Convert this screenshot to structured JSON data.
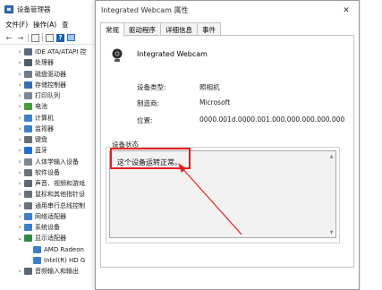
{
  "device_manager": {
    "title": "设备管理器",
    "menu": [
      "文件(F)",
      "操作(A)",
      "查"
    ],
    "tree": [
      {
        "label": "IDE ATA/ATAPI 控",
        "icon_color": "#5a6c7e",
        "indent": 0,
        "expanded": false
      },
      {
        "label": "处理器",
        "icon_color": "#4f5b66",
        "indent": 0,
        "expanded": false
      },
      {
        "label": "磁盘驱动器",
        "icon_color": "#6f7b86",
        "indent": 0,
        "expanded": false
      },
      {
        "label": "存储控制器",
        "icon_color": "#3b6fae",
        "indent": 0,
        "expanded": false
      },
      {
        "label": "打印队列",
        "icon_color": "#7b8893",
        "indent": 0,
        "expanded": false
      },
      {
        "label": "电池",
        "icon_color": "#4a9a3a",
        "indent": 0,
        "expanded": false
      },
      {
        "label": "计算机",
        "icon_color": "#3f7fc7",
        "indent": 0,
        "expanded": false
      },
      {
        "label": "监视器",
        "icon_color": "#3f7fc7",
        "indent": 0,
        "expanded": false
      },
      {
        "label": "键盘",
        "icon_color": "#666f78",
        "indent": 0,
        "expanded": false
      },
      {
        "label": "蓝牙",
        "icon_color": "#1f6fd0",
        "indent": 0,
        "expanded": false
      },
      {
        "label": "人体学输入设备",
        "icon_color": "#7d8791",
        "indent": 0,
        "expanded": false
      },
      {
        "label": "软件设备",
        "icon_color": "#6a737c",
        "indent": 0,
        "expanded": false
      },
      {
        "label": "声音、视频和游戏",
        "icon_color": "#5d6772",
        "indent": 0,
        "expanded": false
      },
      {
        "label": "鼠标和其他指针设",
        "icon_color": "#6a737c",
        "indent": 0,
        "expanded": false
      },
      {
        "label": "通用串行总线控制",
        "icon_color": "#6a737c",
        "indent": 0,
        "expanded": false
      },
      {
        "label": "网络适配器",
        "icon_color": "#3f7fc7",
        "indent": 0,
        "expanded": false
      },
      {
        "label": "系统设备",
        "icon_color": "#3f7fc7",
        "indent": 0,
        "expanded": false
      },
      {
        "label": "显示适配器",
        "icon_color": "#2f8a4a",
        "indent": 0,
        "expanded": true
      },
      {
        "label": "AMD Radeon",
        "icon_color": "#3f7fc7",
        "indent": 1,
        "expanded": null
      },
      {
        "label": "Intel(R) HD G",
        "icon_color": "#3f7fc7",
        "indent": 1,
        "expanded": null
      },
      {
        "label": "音频输入和输出",
        "icon_color": "#5d6772",
        "indent": 0,
        "expanded": false
      }
    ]
  },
  "dialog": {
    "title": "Integrated Webcam 属性",
    "close_glyph": "✕",
    "tabs": [
      "常规",
      "驱动程序",
      "详细信息",
      "事件"
    ],
    "device_name": "Integrated Webcam",
    "props": [
      {
        "label": "设备类型:",
        "value": "照相机"
      },
      {
        "label": "制造商:",
        "value": "Microsoft"
      },
      {
        "label": "位置:",
        "value": "0000.001d.0000.001.000.000.000.000.000"
      }
    ],
    "status_legend": "设备状态",
    "status_text": "这个设备运转正常。"
  },
  "annotation": {
    "highlight_color": "#e41f1f"
  }
}
